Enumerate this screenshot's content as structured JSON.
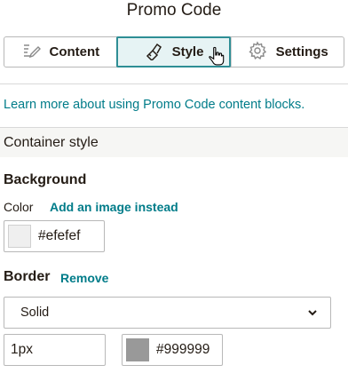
{
  "panel": {
    "title": "Promo Code"
  },
  "tabs": [
    {
      "label": "Content",
      "icon": "edit-pen-icon"
    },
    {
      "label": "Style",
      "icon": "paint-brush-icon"
    },
    {
      "label": "Settings",
      "icon": "gear-icon"
    }
  ],
  "learn_link": "Learn more about using Promo Code content blocks.",
  "container_style": {
    "header": "Container style",
    "background": {
      "label": "Background",
      "color_label": "Color",
      "image_link": "Add an image instead",
      "color_value": "#efefef"
    },
    "border": {
      "label": "Border",
      "remove_link": "Remove",
      "style_value": "Solid",
      "width_value": "1px",
      "color_value": "#999999"
    }
  },
  "colors": {
    "accent": "#007c89",
    "active_tab_border": "#2e8e95",
    "active_tab_bg": "#e6f3f4"
  }
}
